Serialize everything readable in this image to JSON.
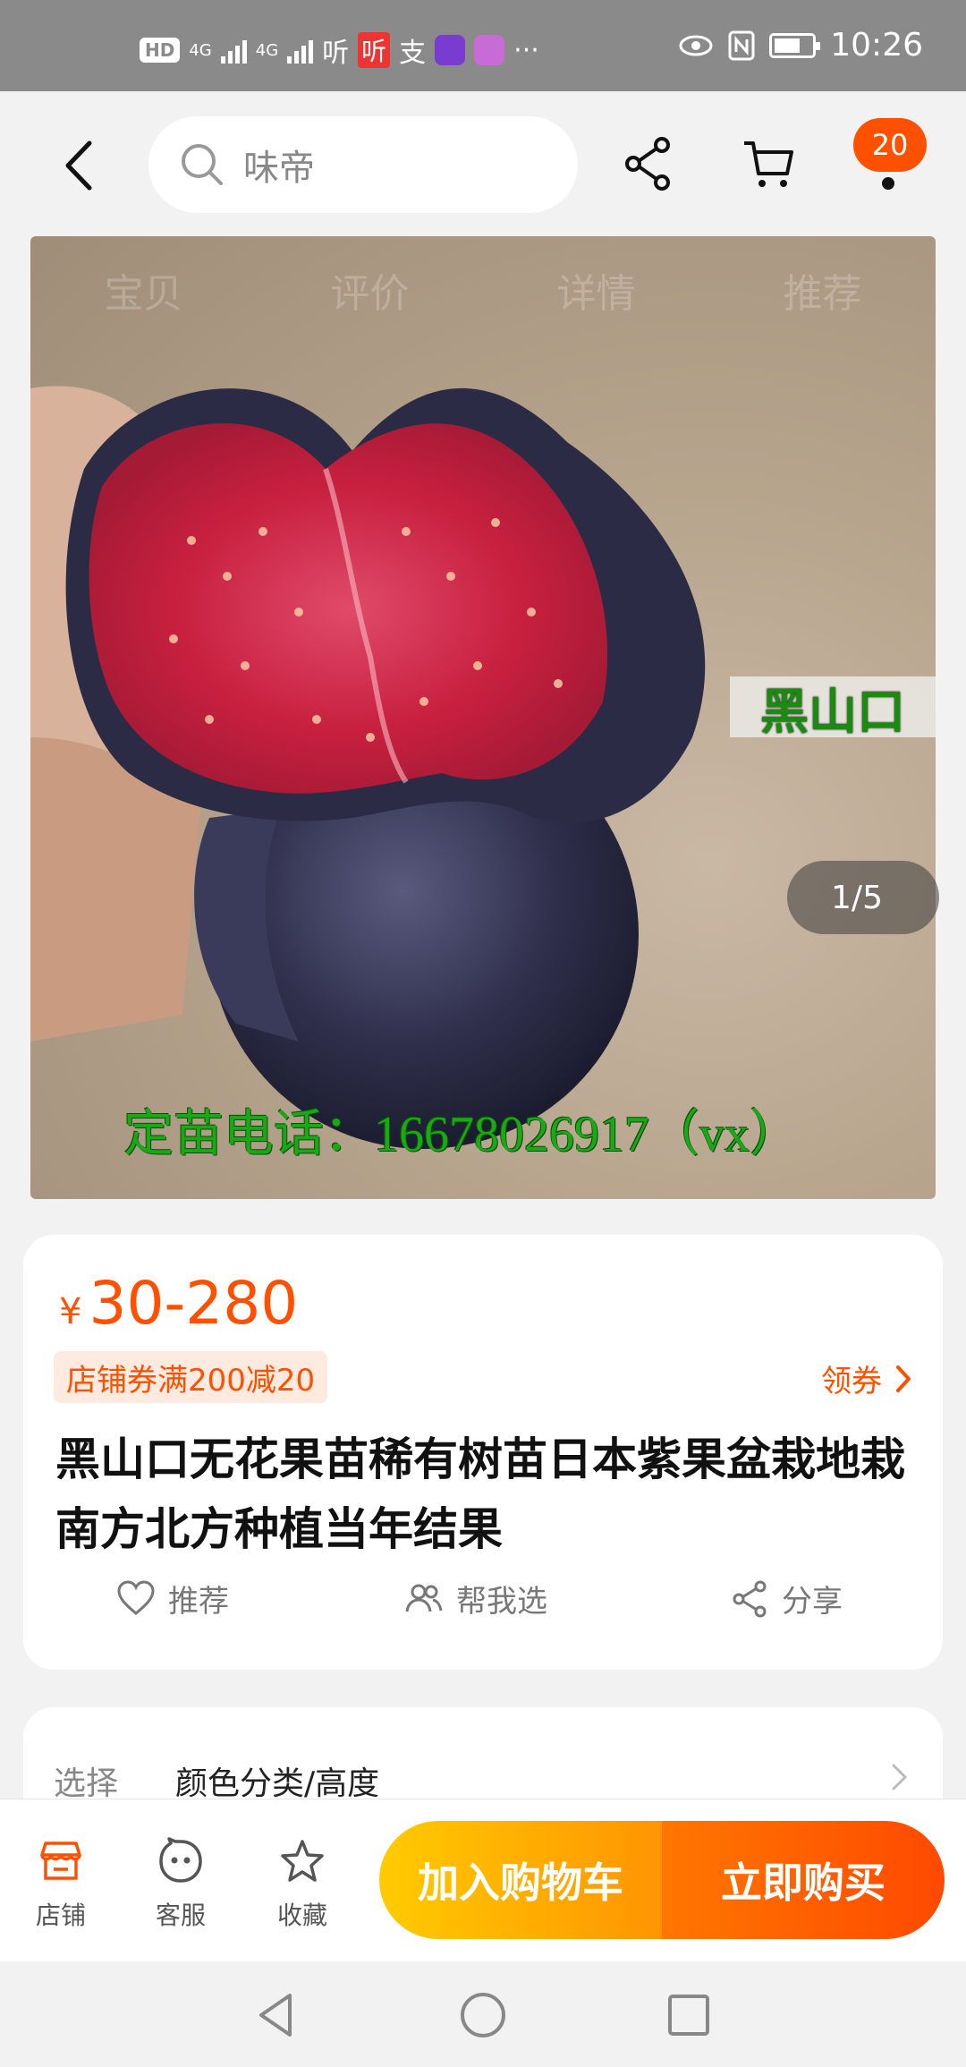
{
  "status_bar": {
    "hd_label": "HD",
    "net1": "4G",
    "net2": "4G",
    "app_icon_text": "听",
    "pay_icon_text": "支",
    "ellipsis": "···",
    "time": "10:26"
  },
  "search": {
    "placeholder": "味帝"
  },
  "cart_badge": "20",
  "photo": {
    "tabs": [
      "宝贝",
      "评价",
      "详情",
      "推荐"
    ],
    "overlay_tag": "黑山口",
    "phone_text": "定苗电话：16678026917（vx）",
    "counter": "1/5"
  },
  "price": {
    "currency": "¥",
    "value": "30-280"
  },
  "coupon": {
    "tag": "店铺券满200减20",
    "link_label": "领券"
  },
  "product_title": "黑山口无花果苗稀有树苗日本紫果盆栽地栽南方北方种植当年结果",
  "actions": {
    "recommend": "推荐",
    "help_choose": "帮我选",
    "share": "分享"
  },
  "select": {
    "label": "选择",
    "value": "颜色分类/高度"
  },
  "bottom_bar": {
    "store": "店铺",
    "service": "客服",
    "favorite": "收藏",
    "add_to_cart": "加入购物车",
    "buy_now": "立即购买"
  },
  "colors": {
    "accent": "#ff5000",
    "cart_gradient": [
      "#ffcb00",
      "#ff9402"
    ],
    "buy_gradient": [
      "#ff7700",
      "#ff4900"
    ]
  }
}
